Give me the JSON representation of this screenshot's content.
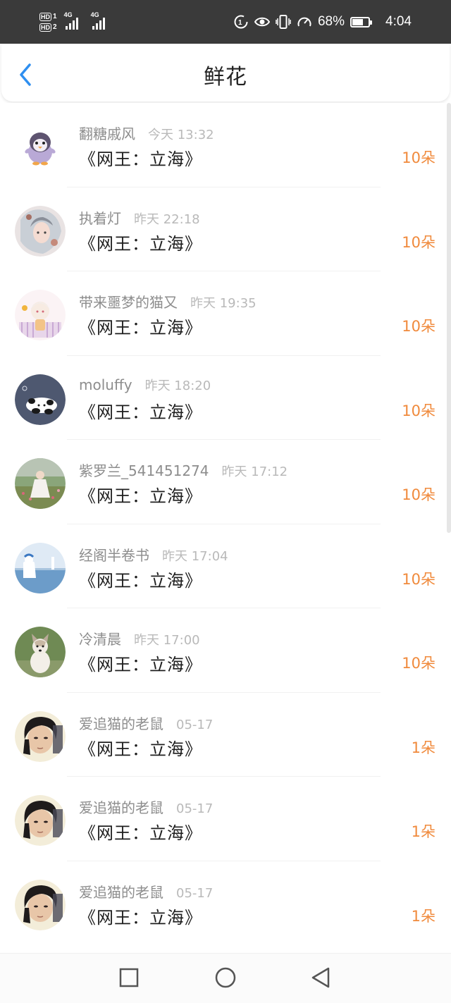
{
  "status_bar": {
    "hd1": "HD",
    "hd1_sub": "1",
    "hd2": "HD",
    "hd2_sub": "2",
    "network1": "4G",
    "network2": "4G",
    "battery_percent": "68%",
    "battery_level": 0.68,
    "time": "4:04",
    "icons": [
      "hd-icon",
      "signal-icon",
      "data-saver-icon",
      "eye-comfort-icon",
      "vibrate-icon",
      "speed-icon",
      "battery-icon"
    ]
  },
  "header": {
    "title": "鲜花",
    "back_icon": "back-chevron-icon"
  },
  "items": [
    {
      "name": "翻糖戚风",
      "time": "今天 13:32",
      "book": "《网王：立海》",
      "count": "10朵",
      "avatar": "penguin"
    },
    {
      "name": "执着灯",
      "time": "昨天 22:18",
      "book": "《网王：立海》",
      "count": "10朵",
      "avatar": "anime-girl"
    },
    {
      "name": "带来噩梦的猫又",
      "time": "昨天 19:35",
      "book": "《网王：立海》",
      "count": "10朵",
      "avatar": "chibi"
    },
    {
      "name": "moluffy",
      "time": "昨天 18:20",
      "book": "《网王：立海》",
      "count": "10朵",
      "avatar": "panda"
    },
    {
      "name": "紫罗兰_541451274",
      "time": "昨天 17:12",
      "book": "《网王：立海》",
      "count": "10朵",
      "avatar": "flower-field"
    },
    {
      "name": "经阁半卷书",
      "time": "昨天 17:04",
      "book": "《网王：立海》",
      "count": "10朵",
      "avatar": "sea-boy"
    },
    {
      "name": "冷清晨",
      "time": "昨天 17:00",
      "book": "《网王：立海》",
      "count": "10朵",
      "avatar": "puppy"
    },
    {
      "name": "爱追猫的老鼠",
      "time": "05-17",
      "book": "《网王：立海》",
      "count": "1朵",
      "avatar": "man-portrait"
    },
    {
      "name": "爱追猫的老鼠",
      "time": "05-17",
      "book": "《网王：立海》",
      "count": "1朵",
      "avatar": "man-portrait"
    },
    {
      "name": "爱追猫的老鼠",
      "time": "05-17",
      "book": "《网王：立海》",
      "count": "1朵",
      "avatar": "man-portrait"
    }
  ],
  "nav_bar": {
    "icons": [
      "recent-apps-icon",
      "home-icon",
      "back-icon"
    ]
  },
  "colors": {
    "status_bar": "#3a3a3a",
    "accent_blue": "#2f8ff0",
    "count_orange": "#f08a3c",
    "name_gray": "#8d8d8d",
    "time_gray": "#b9b9b9"
  }
}
